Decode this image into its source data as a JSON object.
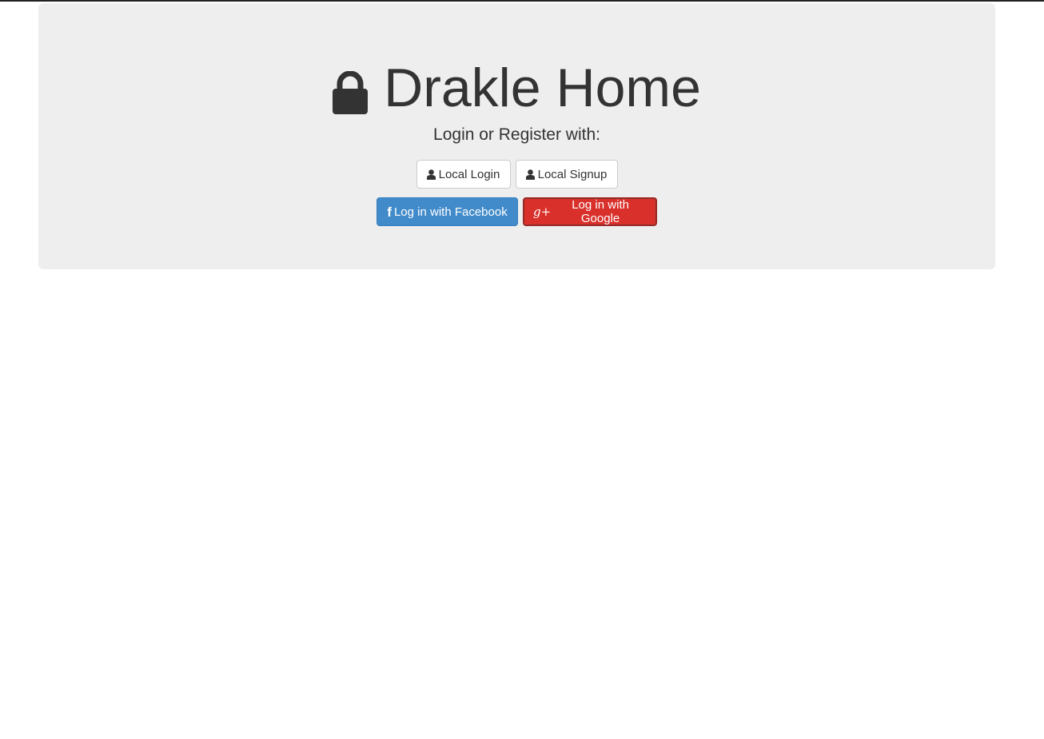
{
  "header": {
    "title": "Drakle Home",
    "lock_icon": "lock-icon"
  },
  "subtitle": "Login or Register with:",
  "buttons": {
    "local_login": {
      "label": "Local Login",
      "icon": "user-icon"
    },
    "local_signup": {
      "label": "Local Signup",
      "icon": "user-icon"
    },
    "facebook": {
      "label": "Log in with Facebook",
      "icon": "facebook-icon",
      "icon_glyph": "f",
      "color": "#428bca"
    },
    "google": {
      "label": "Log in with Google",
      "icon": "google-plus-icon",
      "icon_glyph": "g+",
      "color": "#d9302b"
    }
  },
  "colors": {
    "jumbotron_bg": "#eeeeee",
    "text": "#333333"
  }
}
